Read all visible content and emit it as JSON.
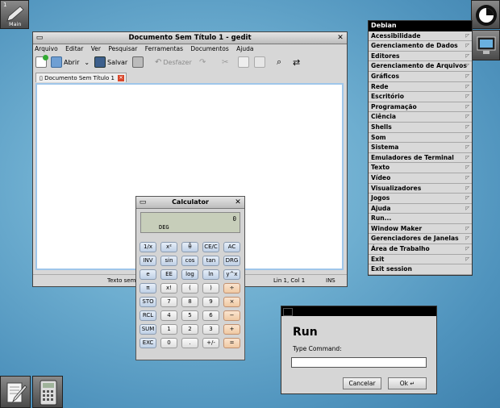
{
  "dock": {
    "main_tile": {
      "number": "1",
      "label": "Main"
    },
    "bottom_icons": [
      "text-editor-icon",
      "calculator-icon"
    ],
    "top_right_icons": [
      "clip-icon",
      "monitor-icon"
    ]
  },
  "gedit": {
    "title": "Documento Sem Título 1 - gedit",
    "menu": [
      "Arquivo",
      "Editar",
      "Ver",
      "Pesquisar",
      "Ferramentas",
      "Documentos",
      "Ajuda"
    ],
    "toolbar": {
      "open": "Abrir",
      "save": "Salvar",
      "undo": "Desfazer"
    },
    "tab_label": "Documento Sem Título 1",
    "status": {
      "left": "Texto sem",
      "position": "Lin 1, Col 1",
      "mode": "INS"
    }
  },
  "calculator": {
    "title": "Calculator",
    "display_value": "0",
    "display_mode": "DEG",
    "rows": [
      [
        "1/x",
        "x²",
        "θ̂",
        "CE/C",
        "AC"
      ],
      [
        "INV",
        "sin",
        "cos",
        "tan",
        "DRG"
      ],
      [
        "e",
        "EE",
        "log",
        "ln",
        "y^x"
      ],
      [
        "π",
        "x!",
        "(",
        ")",
        "÷"
      ],
      [
        "STO",
        "7",
        "8",
        "9",
        "×"
      ],
      [
        "RCL",
        "4",
        "5",
        "6",
        "−"
      ],
      [
        "SUM",
        "1",
        "2",
        "3",
        "+"
      ],
      [
        "EXC",
        "0",
        ".",
        "+/-",
        "="
      ]
    ]
  },
  "root_menu": {
    "title": "Debian",
    "items": [
      {
        "label": "Acessibilidade",
        "submenu": true
      },
      {
        "label": "Gerenciamento de Dados",
        "submenu": true
      },
      {
        "label": "Editores",
        "submenu": true
      },
      {
        "label": "Gerenciamento de Arquivos",
        "submenu": true
      },
      {
        "label": "Gráficos",
        "submenu": true
      },
      {
        "label": "Rede",
        "submenu": true
      },
      {
        "label": "Escritório",
        "submenu": true
      },
      {
        "label": "Programação",
        "submenu": true
      },
      {
        "label": "Ciência",
        "submenu": true
      },
      {
        "label": "Shells",
        "submenu": true
      },
      {
        "label": "Som",
        "submenu": true
      },
      {
        "label": "Sistema",
        "submenu": true
      },
      {
        "label": "Emuladores de Terminal",
        "submenu": true
      },
      {
        "label": "Texto",
        "submenu": true
      },
      {
        "label": "Vídeo",
        "submenu": true
      },
      {
        "label": "Visualizadores",
        "submenu": true
      },
      {
        "label": "Jogos",
        "submenu": true
      },
      {
        "label": "Ajuda",
        "submenu": true
      },
      {
        "label": "Run...",
        "submenu": false
      },
      {
        "label": "Window Maker",
        "submenu": true
      },
      {
        "label": "Gerenciadores de Janelas",
        "submenu": true
      },
      {
        "label": "Área de Trabalho",
        "submenu": true
      },
      {
        "label": "Exit",
        "submenu": true
      },
      {
        "label": "Exit session",
        "submenu": false
      }
    ]
  },
  "run_dialog": {
    "title": "Run",
    "prompt": "Type Command:",
    "input_value": "",
    "cancel": "Cancelar",
    "ok": "Ok"
  }
}
